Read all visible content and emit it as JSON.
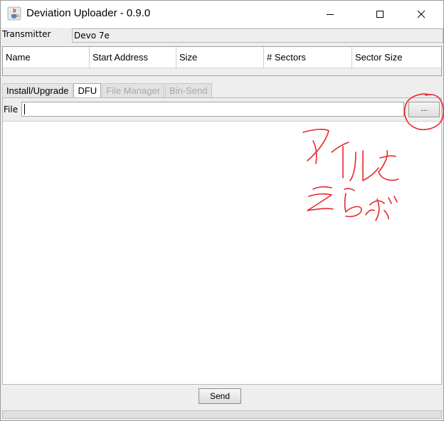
{
  "window": {
    "title": "Deviation Uploader - 0.9.0",
    "controls": [
      "minimize-icon",
      "maximize-icon",
      "close-icon"
    ]
  },
  "transmitter": {
    "label": "Transmitter",
    "value": "Devo 7e"
  },
  "table": {
    "columns": [
      "Name",
      "Start Address",
      "Size",
      "# Sectors",
      "Sector Size"
    ]
  },
  "tabs": [
    {
      "label": "Install/Upgrade",
      "state": "normal"
    },
    {
      "label": "DFU",
      "state": "active"
    },
    {
      "label": "File Manager",
      "state": "disabled"
    },
    {
      "label": "Bin-Send",
      "state": "disabled"
    }
  ],
  "dfu": {
    "file_label": "File",
    "file_value": "",
    "browse_label": "..."
  },
  "actions": {
    "send_label": "Send"
  },
  "colors": {
    "annotation": "#e8262a",
    "window_bg": "#eeeeee",
    "disabled_text": "#a8a8a8"
  }
}
